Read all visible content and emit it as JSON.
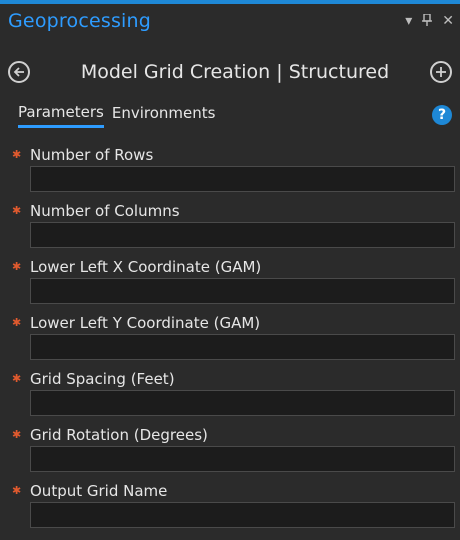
{
  "pane": {
    "title": "Geoprocessing",
    "window_controls": {
      "menu_icon": "dropdown-arrow",
      "pin_icon": "pin",
      "close_icon": "close"
    }
  },
  "tool": {
    "title": "Model Grid Creation | Structured",
    "back_icon": "back-arrow",
    "add_icon": "add-circle"
  },
  "tabs": [
    {
      "label": "Parameters",
      "active": true
    },
    {
      "label": "Environments",
      "active": false
    }
  ],
  "help_icon": "?",
  "required_marker": "✱",
  "parameters": [
    {
      "label": "Number of Rows",
      "value": ""
    },
    {
      "label": "Number of Columns",
      "value": ""
    },
    {
      "label": "Lower Left X Coordinate (GAM)",
      "value": ""
    },
    {
      "label": "Lower Left Y Coordinate (GAM)",
      "value": ""
    },
    {
      "label": "Grid Spacing (Feet)",
      "value": ""
    },
    {
      "label": "Grid Rotation (Degrees)",
      "value": ""
    },
    {
      "label": "Output Grid Name",
      "value": ""
    }
  ],
  "colors": {
    "accent": "#2e9cff",
    "required": "#e05a2e",
    "background": "#2b2b2b",
    "input_bg": "#1c1c1c"
  }
}
